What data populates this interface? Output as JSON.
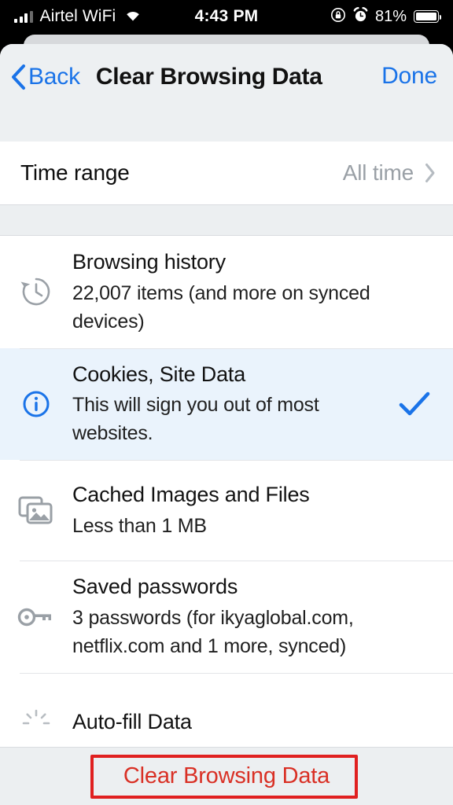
{
  "status_bar": {
    "carrier": "Airtel WiFi",
    "time": "4:43 PM",
    "battery_percent": "81%",
    "signal_icon": "signal-bars-icon",
    "wifi_icon": "wifi-icon",
    "rotation_lock_icon": "rotation-lock-icon",
    "alarm_icon": "alarm-clock-icon",
    "battery_icon": "battery-icon"
  },
  "navbar": {
    "back_label": "Back",
    "title": "Clear Browsing Data",
    "done_label": "Done",
    "back_icon": "chevron-left-icon",
    "accent_color": "#1a73e8"
  },
  "time_range": {
    "label": "Time range",
    "value": "All time",
    "chevron_icon": "chevron-right-icon"
  },
  "list": {
    "items": [
      {
        "icon": "history-icon",
        "title": "Browsing history",
        "subtitle": "22,007 items (and more on synced devices)",
        "selected": false,
        "check": ""
      },
      {
        "icon": "info-circle-icon",
        "title": "Cookies, Site Data",
        "subtitle": "This will sign you out of most websites.",
        "selected": true,
        "check": "checkmark-icon"
      },
      {
        "icon": "cached-images-icon",
        "title": "Cached Images and Files",
        "subtitle": "Less than 1 MB",
        "selected": false,
        "check": ""
      },
      {
        "icon": "key-icon",
        "title": "Saved passwords",
        "subtitle": "3 passwords (for ikyaglobal.com, netflix.com and 1 more, synced)",
        "selected": false,
        "check": ""
      },
      {
        "icon": "autofill-icon",
        "title": "Auto-fill Data",
        "subtitle": "",
        "selected": false,
        "check": ""
      }
    ]
  },
  "footer": {
    "button_label": "Clear Browsing Data",
    "button_color": "#d93025",
    "highlight_color": "#e02020"
  }
}
